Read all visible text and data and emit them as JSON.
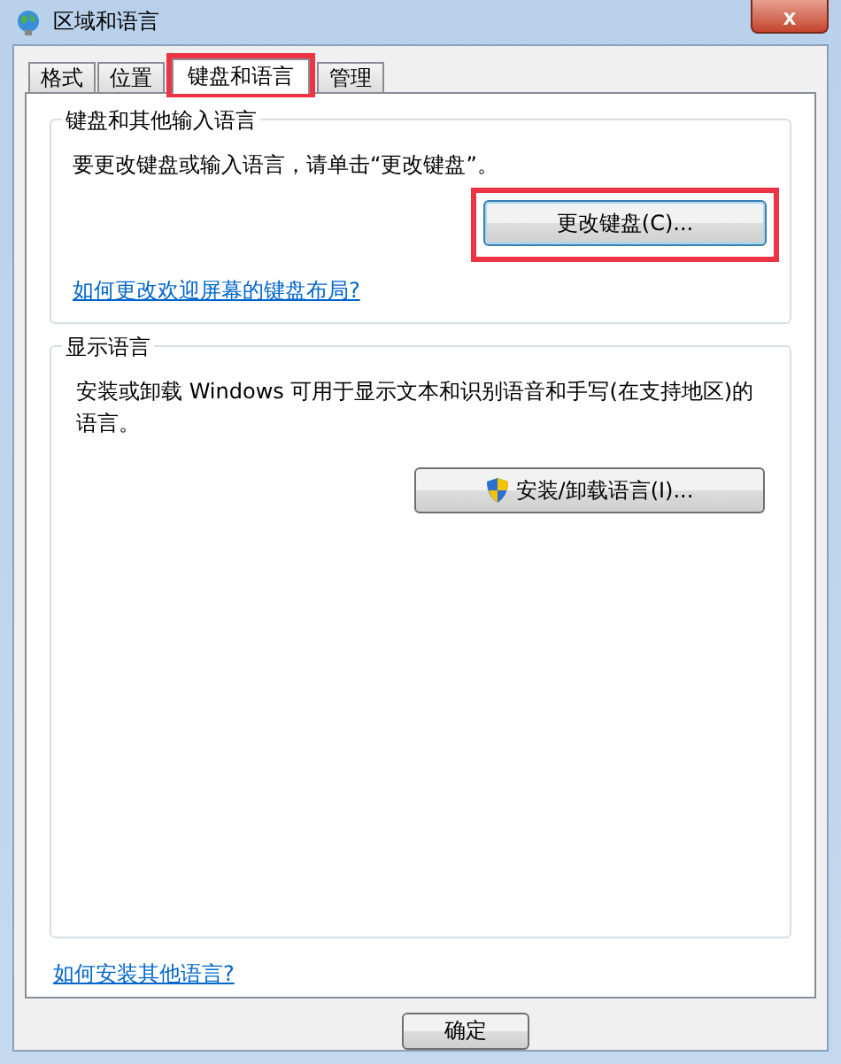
{
  "window": {
    "title": "区域和语言",
    "close": "x"
  },
  "tabs": [
    {
      "label": "格式",
      "selected": false,
      "highlighted": false
    },
    {
      "label": "位置",
      "selected": false,
      "highlighted": false
    },
    {
      "label": "键盘和语言",
      "selected": true,
      "highlighted": true
    },
    {
      "label": "管理",
      "selected": false,
      "highlighted": false
    }
  ],
  "keyboard_group": {
    "title": "键盘和其他输入语言",
    "description": "要更改键盘或输入语言，请单击“更改键盘”。",
    "button": {
      "label": "更改键盘(C)...",
      "highlighted": true
    },
    "link": "如何更改欢迎屏幕的键盘布局?"
  },
  "display_group": {
    "title": "显示语言",
    "description": "安装或卸载 Windows 可用于显示文本和识别语音和手写(在支持地区)的语言。",
    "button": {
      "label": "安装/卸载语言(I)..."
    }
  },
  "bottom_link": "如何安装其他语言?",
  "buttons": [
    "确定"
  ]
}
